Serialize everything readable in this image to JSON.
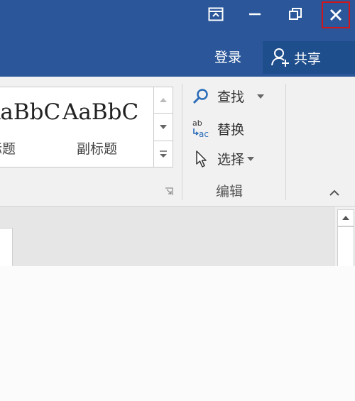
{
  "titlebar": {
    "ribbon_display_icon": "ribbon-display-options-icon",
    "minimize_icon": "minimize-icon",
    "restore_icon": "restore-icon",
    "close_icon": "close-icon"
  },
  "account": {
    "login_label": "登录",
    "share_label": "共享",
    "share_icon": "add-person-icon"
  },
  "styles": {
    "items": [
      {
        "sample": "AaBbC",
        "name": "标题"
      },
      {
        "sample": "AaBbC",
        "name": "副标题"
      }
    ]
  },
  "editing": {
    "find_label": "查找",
    "find_icon": "magnifier-icon",
    "replace_label": "替换",
    "replace_icon": "ab-ac-replace-icon",
    "select_label": "选择",
    "select_icon": "cursor-arrow-icon",
    "group_label": "编辑"
  },
  "colors": {
    "titlebar": "#2b579a",
    "share_bg": "#1f4e8c",
    "close_highlight": "#d0161c"
  }
}
